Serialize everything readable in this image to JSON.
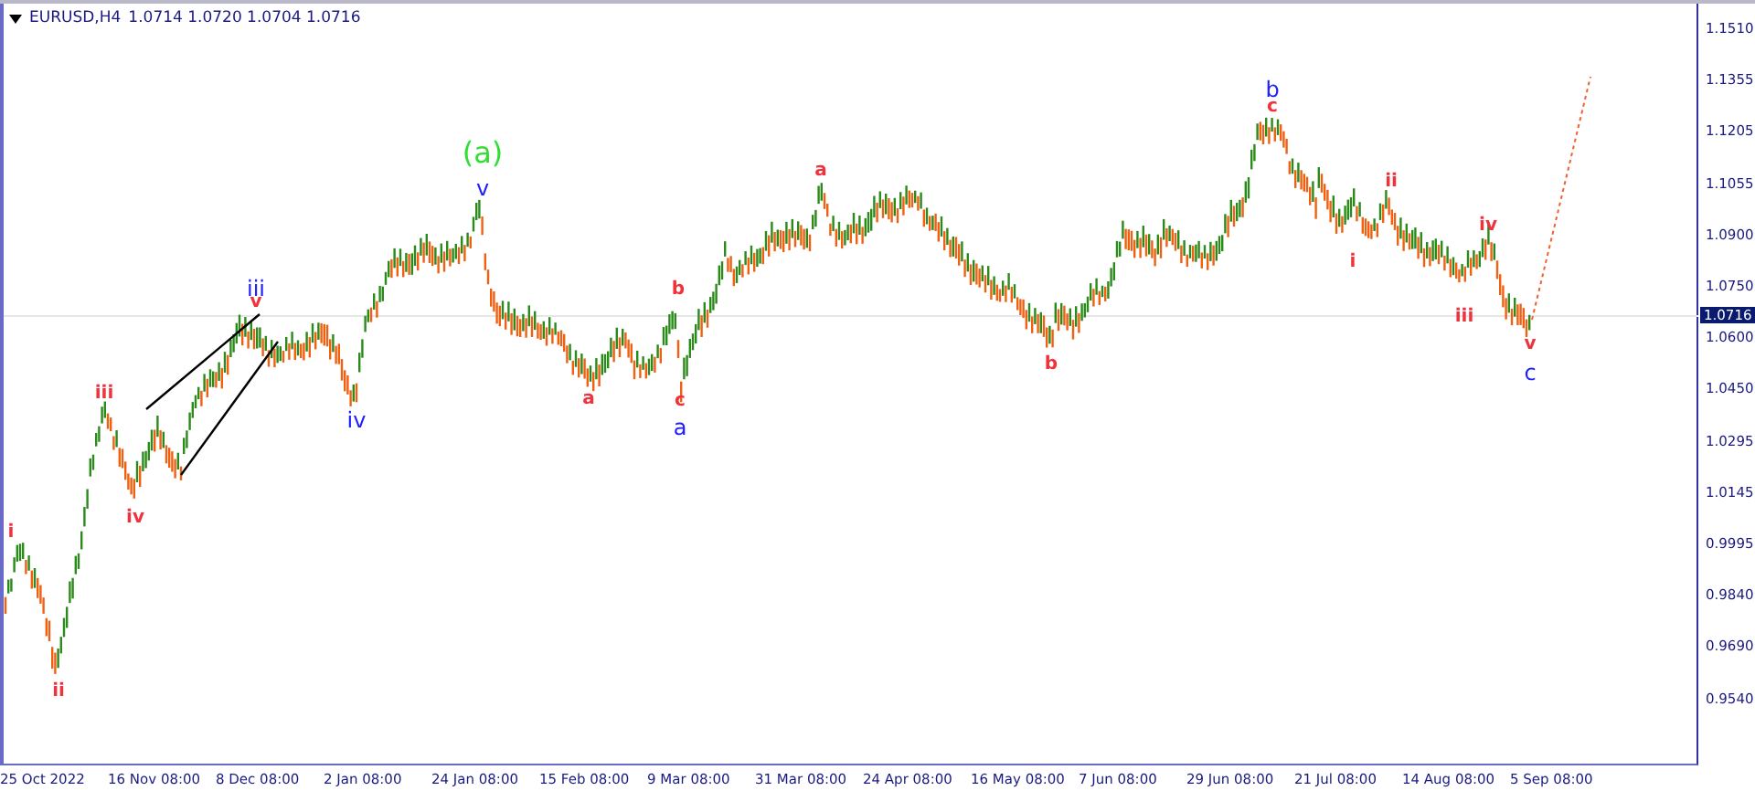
{
  "header": {
    "symbol": "EURUSD,H4",
    "quotes": "1.0714 1.0720 1.0704 1.0716"
  },
  "price_axis": [
    "1.1510",
    "1.1355",
    "1.1205",
    "1.1055",
    "1.0900",
    "1.0750",
    "1.0600",
    "1.0450",
    "1.0295",
    "1.0145",
    "0.9995",
    "0.9840",
    "0.9690",
    "0.9540"
  ],
  "current_price": "1.0716",
  "time_axis": [
    "25 Oct 2022",
    "16 Nov 08:00",
    "8 Dec 08:00",
    "2 Jan 08:00",
    "24 Jan 08:00",
    "15 Feb 08:00",
    "9 Mar 08:00",
    "31 Mar 08:00",
    "24 Apr 08:00",
    "16 May 08:00",
    "7 Jun 08:00",
    "29 Jun 08:00",
    "21 Jul 08:00",
    "14 Aug 08:00",
    "5 Sep 08:00"
  ],
  "wave_labels": [
    {
      "text": "i",
      "color": "#f0323c",
      "kind": "minor"
    },
    {
      "text": "ii",
      "color": "#f0323c",
      "kind": "minor"
    },
    {
      "text": "iii",
      "color": "#f0323c",
      "kind": "minor"
    },
    {
      "text": "iv",
      "color": "#f0323c",
      "kind": "minor"
    },
    {
      "text": "iii",
      "color": "#2020ff",
      "kind": "intermediate"
    },
    {
      "text": "v",
      "color": "#f0323c",
      "kind": "minor"
    },
    {
      "text": "iv",
      "color": "#2020ff",
      "kind": "intermediate"
    },
    {
      "text": "(a)",
      "color": "#33dd33",
      "kind": "primary"
    },
    {
      "text": "v",
      "color": "#2020ff",
      "kind": "intermediate"
    },
    {
      "text": "a",
      "color": "#f0323c",
      "kind": "minor"
    },
    {
      "text": "b",
      "color": "#f0323c",
      "kind": "minor"
    },
    {
      "text": "c",
      "color": "#f0323c",
      "kind": "minor"
    },
    {
      "text": "a",
      "color": "#2020ff",
      "kind": "intermediate"
    },
    {
      "text": "a",
      "color": "#f0323c",
      "kind": "minor"
    },
    {
      "text": "b",
      "color": "#f0323c",
      "kind": "minor"
    },
    {
      "text": "b",
      "color": "#2020ff",
      "kind": "intermediate"
    },
    {
      "text": "c",
      "color": "#f0323c",
      "kind": "minor"
    },
    {
      "text": "i",
      "color": "#f0323c",
      "kind": "minor"
    },
    {
      "text": "ii",
      "color": "#f0323c",
      "kind": "minor"
    },
    {
      "text": "iii",
      "color": "#f0323c",
      "kind": "minor"
    },
    {
      "text": "iv",
      "color": "#f0323c",
      "kind": "minor"
    },
    {
      "text": "v",
      "color": "#f0323c",
      "kind": "minor"
    },
    {
      "text": "c",
      "color": "#2020ff",
      "kind": "intermediate"
    }
  ]
}
